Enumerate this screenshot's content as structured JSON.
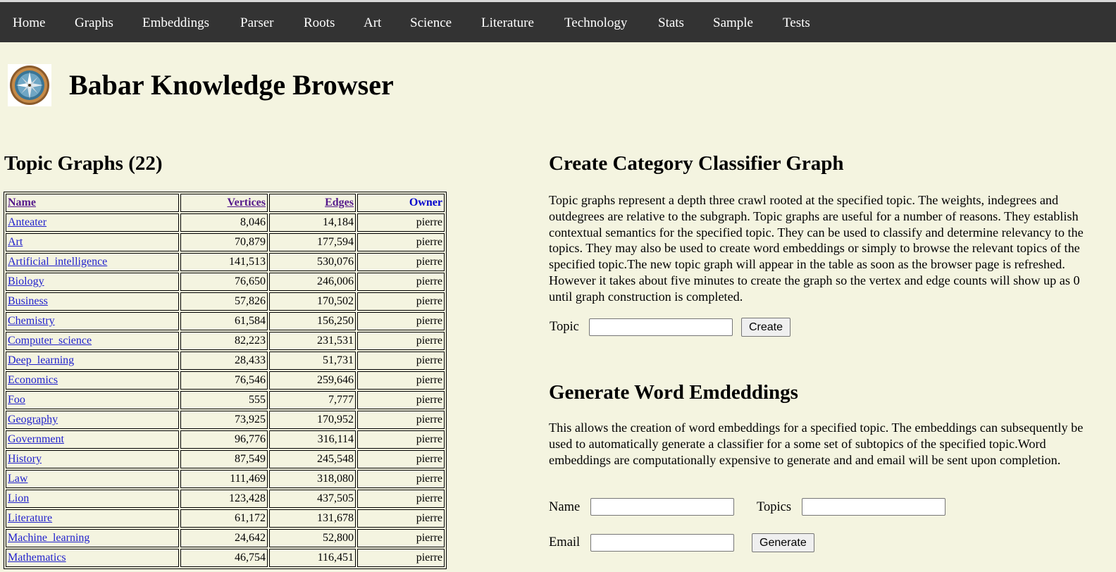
{
  "nav": [
    {
      "label": "Home"
    },
    {
      "label": "Graphs"
    },
    {
      "label": "Embeddings"
    },
    {
      "label": "Parser"
    },
    {
      "label": "Roots"
    },
    {
      "label": "Art"
    },
    {
      "label": "Science"
    },
    {
      "label": "Literature"
    },
    {
      "label": "Technology"
    },
    {
      "label": "Stats"
    },
    {
      "label": "Sample"
    },
    {
      "label": "Tests"
    }
  ],
  "header": {
    "title": "Babar Knowledge Browser",
    "logo_icon": "compass-icon"
  },
  "topics": {
    "title": "Topic Graphs (22)",
    "columns": [
      "Name",
      "Vertices",
      "Edges",
      "Owner"
    ],
    "rows": [
      {
        "name": "Anteater",
        "vertices": "8,046",
        "edges": "14,184",
        "owner": "pierre"
      },
      {
        "name": "Art",
        "vertices": "70,879",
        "edges": "177,594",
        "owner": "pierre"
      },
      {
        "name": "Artificial_intelligence",
        "vertices": "141,513",
        "edges": "530,076",
        "owner": "pierre"
      },
      {
        "name": "Biology",
        "vertices": "76,650",
        "edges": "246,006",
        "owner": "pierre"
      },
      {
        "name": "Business",
        "vertices": "57,826",
        "edges": "170,502",
        "owner": "pierre"
      },
      {
        "name": "Chemistry",
        "vertices": "61,584",
        "edges": "156,250",
        "owner": "pierre"
      },
      {
        "name": "Computer_science",
        "vertices": "82,223",
        "edges": "231,531",
        "owner": "pierre"
      },
      {
        "name": "Deep_learning",
        "vertices": "28,433",
        "edges": "51,731",
        "owner": "pierre"
      },
      {
        "name": "Economics",
        "vertices": "76,546",
        "edges": "259,646",
        "owner": "pierre"
      },
      {
        "name": "Foo",
        "vertices": "555",
        "edges": "7,777",
        "owner": "pierre"
      },
      {
        "name": "Geography",
        "vertices": "73,925",
        "edges": "170,952",
        "owner": "pierre"
      },
      {
        "name": "Government",
        "vertices": "96,776",
        "edges": "316,114",
        "owner": "pierre"
      },
      {
        "name": "History",
        "vertices": "87,549",
        "edges": "245,548",
        "owner": "pierre"
      },
      {
        "name": "Law",
        "vertices": "111,469",
        "edges": "318,080",
        "owner": "pierre"
      },
      {
        "name": "Lion",
        "vertices": "123,428",
        "edges": "437,505",
        "owner": "pierre"
      },
      {
        "name": "Literature",
        "vertices": "61,172",
        "edges": "131,678",
        "owner": "pierre"
      },
      {
        "name": "Machine_learning",
        "vertices": "24,642",
        "edges": "52,800",
        "owner": "pierre"
      },
      {
        "name": "Mathematics",
        "vertices": "46,754",
        "edges": "116,451",
        "owner": "pierre"
      }
    ]
  },
  "classifier": {
    "title": "Create Category Classifier Graph",
    "description": "Topic graphs represent a depth three crawl rooted at the specified topic. The weights, indegrees and outdegrees are relative to the subgraph. Topic graphs are useful for a number of reasons. They establish contextual semantics for the specified topic. They can be used to classify and determine relevancy to the topics. They may also be used to create word embeddings or simply to browse the relevant topics of the specified topic.The new topic graph will appear in the table as soon as the browser page is refreshed. However it takes about five minutes to create the graph so the vertex and edge counts will show up as 0 until graph construction is completed.",
    "topic_label": "Topic",
    "topic_value": "",
    "create_label": "Create"
  },
  "embeddings": {
    "title": "Generate Word Emdeddings",
    "description": "This allows the creation of word embeddings for a specified topic. The embeddings can subsequently be used to automatically generate a classifier for a some set of subtopics of the specified topic.Word embeddings are computationally expensive to generate and and email will be sent upon completion.",
    "name_label": "Name",
    "name_value": "",
    "topics_label": "Topics",
    "topics_value": "",
    "email_label": "Email",
    "email_value": "",
    "generate_label": "Generate"
  }
}
